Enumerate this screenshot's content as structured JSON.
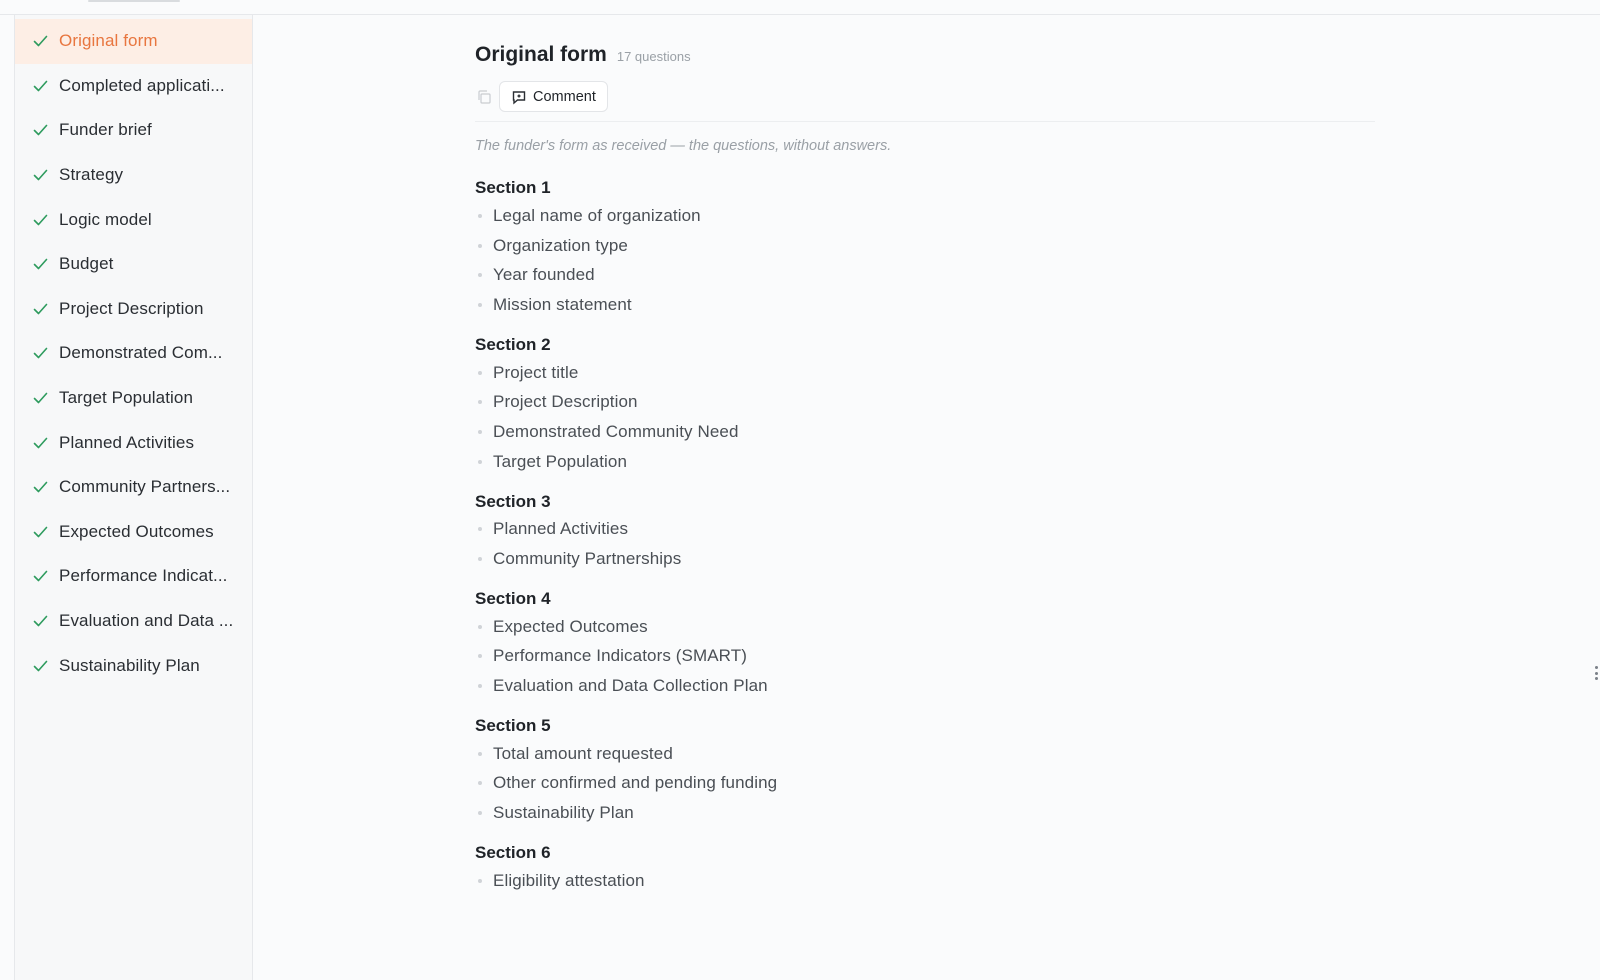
{
  "sidebar": {
    "items": [
      {
        "label": "Original form",
        "active": true
      },
      {
        "label": "Completed applicati..."
      },
      {
        "label": "Funder brief"
      },
      {
        "label": "Strategy"
      },
      {
        "label": "Logic model"
      },
      {
        "label": "Budget"
      },
      {
        "label": "Project Description"
      },
      {
        "label": "Demonstrated Com..."
      },
      {
        "label": "Target Population"
      },
      {
        "label": "Planned Activities"
      },
      {
        "label": "Community Partners..."
      },
      {
        "label": "Expected Outcomes"
      },
      {
        "label": "Performance Indicat..."
      },
      {
        "label": "Evaluation and Data ..."
      },
      {
        "label": "Sustainability Plan"
      }
    ]
  },
  "main": {
    "title": "Original form",
    "question_count": "17 questions",
    "comment_label": "Comment",
    "description": "The funder's form as received — the questions, without answers.",
    "sections": [
      {
        "title": "Section 1",
        "questions": [
          "Legal name of organization",
          "Organization type",
          "Year founded",
          "Mission statement"
        ]
      },
      {
        "title": "Section 2",
        "questions": [
          "Project title",
          "Project Description",
          "Demonstrated Community Need",
          "Target Population"
        ]
      },
      {
        "title": "Section 3",
        "questions": [
          "Planned Activities",
          "Community Partnerships"
        ]
      },
      {
        "title": "Section 4",
        "questions": [
          "Expected Outcomes",
          "Performance Indicators (SMART)",
          "Evaluation and Data Collection Plan"
        ]
      },
      {
        "title": "Section 5",
        "questions": [
          "Total amount requested",
          "Other confirmed and pending funding",
          "Sustainability Plan"
        ]
      },
      {
        "title": "Section 6",
        "questions": [
          "Eligibility attestation"
        ]
      }
    ]
  },
  "colors": {
    "accent": "#e8763f",
    "active_bg": "#fdeee5",
    "check": "#2e9b5e"
  }
}
